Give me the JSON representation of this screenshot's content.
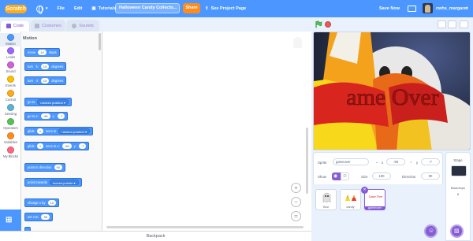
{
  "menubar": {
    "logo": "Scratch",
    "file": "File",
    "edit": "Edit",
    "tutorials": "Tutorials",
    "project_title": "Halloween Candy Collecto...",
    "share": "Share",
    "see_project_page": "See Project Page",
    "save_now": "Save Now",
    "username": "cwhs_margaret"
  },
  "tabs": [
    "Code",
    "Costumes",
    "Sounds"
  ],
  "categories": [
    "Motion",
    "Looks",
    "Sound",
    "Events",
    "Control",
    "Sensing",
    "Operators",
    "Variables",
    "My Blocks"
  ],
  "category_colors": [
    "#4c97ff",
    "#9966ff",
    "#cf63cf",
    "#ffbf00",
    "#ffab19",
    "#5cb1d6",
    "#59c059",
    "#ff8c1a",
    "#ff6680"
  ],
  "palette": {
    "title": "Motion",
    "move": {
      "pre": "move",
      "v": "10",
      "post": "steps"
    },
    "turn_right": {
      "pre": "turn",
      "v": "15",
      "post": "degrees"
    },
    "turn_left": {
      "pre": "turn",
      "v": "15",
      "post": "degrees"
    },
    "goto": {
      "pre": "go to",
      "dd": "random position"
    },
    "goto_xy": {
      "pre": "go to x:",
      "x": "-96",
      "mid": "y:",
      "y": "-7"
    },
    "glide_to": {
      "pre": "glide",
      "v": "1",
      "mid": "secs to",
      "dd": "random position"
    },
    "glide_xy": {
      "pre": "glide",
      "v": "1",
      "mid": "secs to x:",
      "x": "-96",
      "mid2": "y:",
      "y": "-7"
    },
    "point_dir": {
      "pre": "point in direction",
      "v": "90"
    },
    "point_towards": {
      "pre": "point towards",
      "dd": "mouse-pointer"
    },
    "change_x": {
      "pre": "change x by",
      "v": "10"
    },
    "set_x": {
      "pre": "set x to",
      "v": "-96"
    }
  },
  "backpack": "Backpack",
  "stage_overlay_text": "ame Over",
  "sprite_info": {
    "sprite_label": "Sprite",
    "sprite_name": "gameover",
    "x_label": "x",
    "x_value": "-96",
    "y_label": "y",
    "y_value": "-7",
    "show_label": "Show",
    "size_label": "Size",
    "size_value": "100",
    "direction_label": "Direction",
    "direction_value": "90"
  },
  "sprites": [
    {
      "name": "Boo"
    },
    {
      "name": "candy"
    },
    {
      "name": "gameover",
      "thumb_text": "Game Over"
    }
  ],
  "stage_pane": {
    "title": "Stage",
    "backdrops_label": "Backdrops",
    "backdrops_count": "8"
  }
}
